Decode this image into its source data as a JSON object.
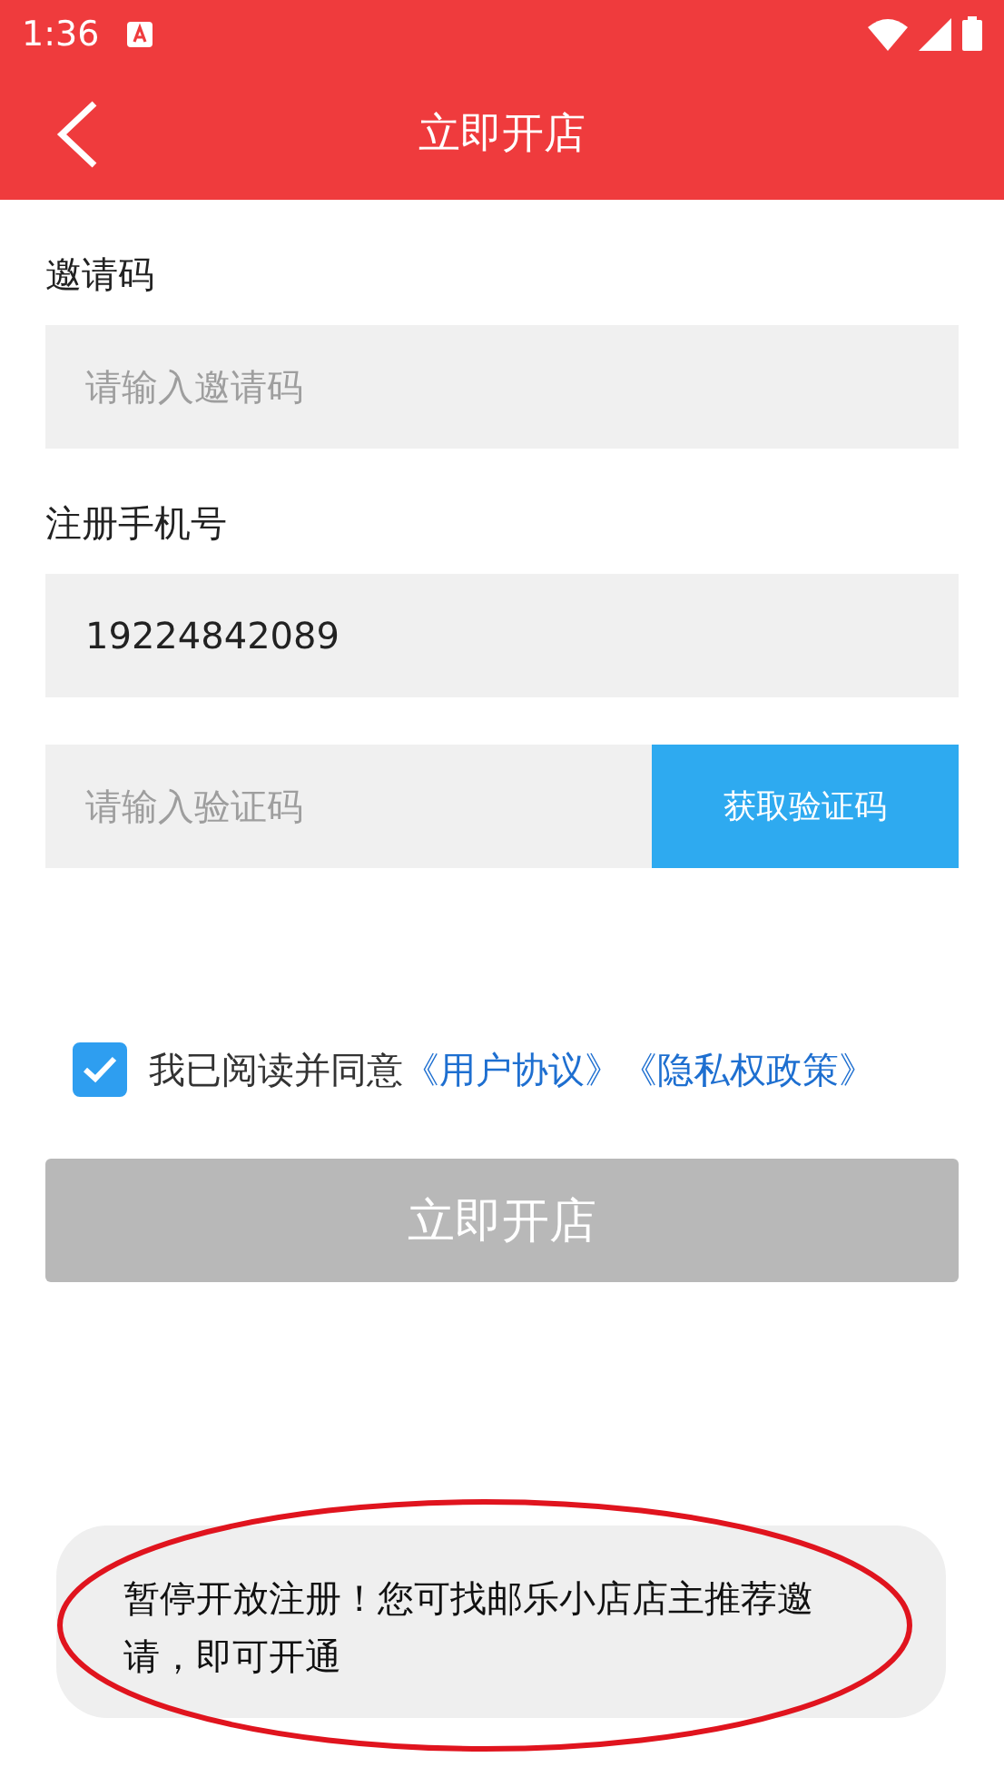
{
  "status_bar": {
    "time": "1:36"
  },
  "toolbar": {
    "title": "立即开店"
  },
  "fields": [
    {
      "label": "邀请码",
      "placeholder": "请输入邀请码"
    },
    {
      "label": "注册手机号",
      "value": "19224842089"
    }
  ],
  "verification": {
    "placeholder": "请输入验证码",
    "button": "获取验证码"
  },
  "agreement": {
    "checked": true,
    "text": "我已阅读并同意",
    "links": [
      "《用户协议》",
      "《隐私权政策》"
    ]
  },
  "submit": {
    "label": "立即开店",
    "disabled": true
  },
  "toast": {
    "text": "暂停开放注册！您可找邮乐小店店主推荐邀请，即可开通"
  }
}
